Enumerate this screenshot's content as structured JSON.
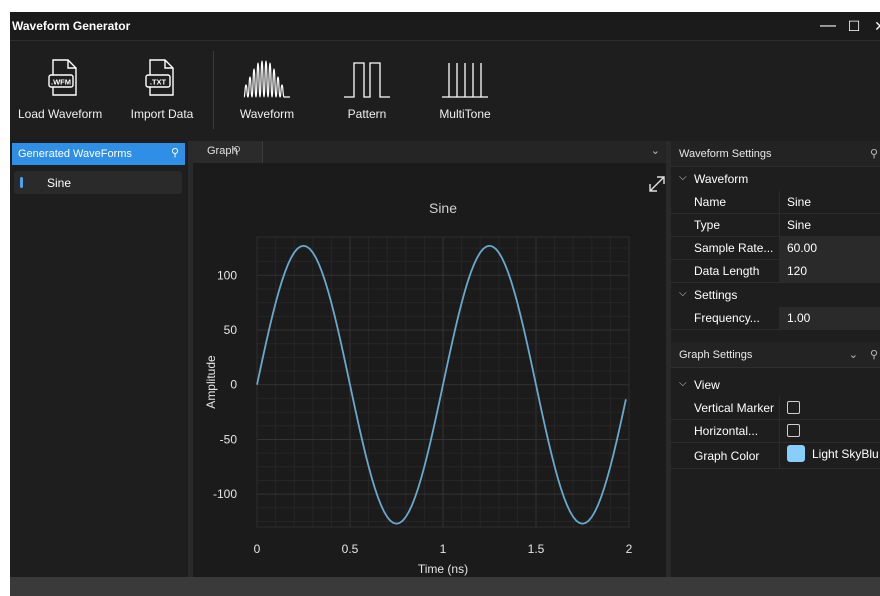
{
  "window": {
    "title": "Waveform Generator",
    "minimize": "—",
    "maximize": "☐",
    "close": "✕"
  },
  "toolbar": {
    "load_waveform": {
      "label": "Load Waveform",
      "icon_text": ".WFM",
      "icon": "file-wfm-icon"
    },
    "import_data": {
      "label": "Import Data",
      "icon_text": ".TXT",
      "icon": "file-txt-icon"
    },
    "waveform": {
      "label": "Waveform",
      "icon": "waveform-icon"
    },
    "pattern": {
      "label": "Pattern",
      "icon": "pattern-icon"
    },
    "multitone": {
      "label": "MultiTone",
      "icon": "multitone-icon"
    }
  },
  "left_panel": {
    "header": "Generated WaveForms",
    "pin": "⚲",
    "items": [
      {
        "label": "Sine"
      }
    ]
  },
  "graph_panel": {
    "tab": "Graph",
    "pin": "⚲",
    "chevron": "⌄"
  },
  "chart_data": {
    "type": "line",
    "title": "Sine",
    "xlabel": "Time (ns)",
    "ylabel": "Amplitude",
    "xlim": [
      0,
      2
    ],
    "ylim": [
      -130,
      135
    ],
    "xticks": [
      "0",
      "0.5",
      "1",
      "1.5",
      "2"
    ],
    "yticks": [
      "100",
      "50",
      "0",
      "-50",
      "-100"
    ],
    "grid": true,
    "line_color": "#6aa9cc",
    "series": [
      {
        "amplitude": 127,
        "frequency": 1.0,
        "sample_rate": 60,
        "samples": 120
      }
    ]
  },
  "waveform_settings": {
    "header": "Waveform Settings",
    "group_waveform": "Waveform",
    "props": [
      {
        "name": "Name",
        "value": "Sine"
      },
      {
        "name": "Type",
        "value": "Sine"
      },
      {
        "name": "Sample Rate...",
        "value": "60.00"
      },
      {
        "name": "Data Length",
        "value": "120"
      }
    ],
    "group_settings": "Settings",
    "settings_props": [
      {
        "name": "Frequency...",
        "value": "1.00"
      }
    ]
  },
  "graph_settings": {
    "header": "Graph Settings",
    "group_view": "View",
    "props": [
      {
        "name": "Vertical Marker",
        "checked": false
      },
      {
        "name": "Horizontal...",
        "checked": false
      },
      {
        "name": "Graph Color",
        "value": "Light SkyBlu",
        "color": "#87cefa"
      }
    ]
  },
  "colors": {
    "accent": "#2f8ee6",
    "background": "#1e1e1e",
    "series": "#6aa9cc"
  }
}
